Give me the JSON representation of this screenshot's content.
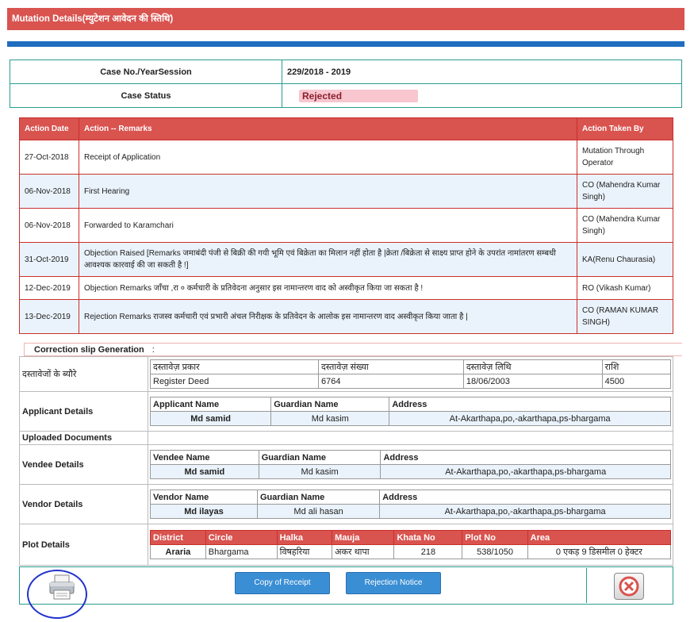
{
  "header": {
    "title": "Mutation Details(म्युटेशन आवेदन की स्तिथि)"
  },
  "case": {
    "case_label": "Case No./YearSession",
    "case_value": "229/2018 - 2019",
    "status_label": "Case Status",
    "status_value": "Rejected"
  },
  "actions": {
    "headers": [
      "Action Date",
      "Action -- Remarks",
      "Action Taken By"
    ],
    "rows": [
      {
        "date": "27-Oct-2018",
        "remark": "Receipt of Application",
        "by": "Mutation Through Operator"
      },
      {
        "date": "06-Nov-2018",
        "remark": "First Hearing",
        "by": "CO (Mahendra Kumar Singh)"
      },
      {
        "date": "06-Nov-2018",
        "remark": "Forwarded to Karamchari",
        "by": "CO (Mahendra Kumar Singh)"
      },
      {
        "date": "31-Oct-2019",
        "remark": "Objection Raised [Remarks जमाबंदी पंजी से बिक्री की गयी भूमि एवं बिक्रेता का मिलान नहीं होता है |क्रेता /बिक्रेता से साक्ष्य प्राप्त होने के उपरांत नामांतरण सम्बधी आवश्यक कारवाई की जा सकती है !]",
        "by": "KA(Renu Chaurasia)"
      },
      {
        "date": "12-Dec-2019",
        "remark": "Objection Remarks जाँचा ,रा ० कर्मचारी के प्रतिवेदना अनुसार इस नामान्तरण वाद को अस्वीकृत किया जा सकता है !",
        "by": "RO (Vikash Kumar)"
      },
      {
        "date": "13-Dec-2019",
        "remark": "Rejection Remarks राजस्व कर्मचारी एवं प्रभारी अंचल निरीक्षक के प्रतिवेदन के आलोक इस नामान्तरण वाद अस्वीकृत किया जाता है |",
        "by": "CO (RAMAN KUMAR SINGH)"
      }
    ]
  },
  "correction_slip": {
    "label": "Correction slip Generation",
    "sep": ":"
  },
  "documents": {
    "label": "दस्तावेजों के ब्यौरे",
    "headers": [
      "दस्तावेज़ प्रकार",
      "दस्तावेज़ संख्या",
      "दस्तावेज़ लिथि",
      "राशि"
    ],
    "values": [
      "Register Deed",
      "6764",
      "18/06/2003",
      "4500"
    ]
  },
  "applicant": {
    "label": "Applicant Details",
    "headers": [
      "Applicant Name",
      "Guardian Name",
      "Address"
    ],
    "values": [
      "Md samid",
      "Md kasim",
      "At-Akarthapa,po,-akarthapa,ps-bhargama"
    ]
  },
  "uploaded": {
    "label": "Uploaded Documents"
  },
  "vendee": {
    "label": "Vendee Details",
    "headers": [
      "Vendee Name",
      "Guardian Name",
      "Address"
    ],
    "values": [
      "Md samid",
      "Md kasim",
      "At-Akarthapa,po,-akarthapa,ps-bhargama"
    ]
  },
  "vendor": {
    "label": "Vendor Details",
    "headers": [
      "Vendor Name",
      "Guardian Name",
      "Address"
    ],
    "values": [
      "Md ilayas",
      "Md ali hasan",
      "At-Akarthapa,po,-akarthapa,ps-bhargama"
    ]
  },
  "plot": {
    "label": "Plot Details",
    "headers": [
      "District",
      "Circle",
      "Halka",
      "Mauja",
      "Khata No",
      "Plot No",
      "Area"
    ],
    "values": [
      "Araria",
      "Bhargama",
      "विषहरिया",
      "अकर थापा",
      "218",
      "538/1050",
      "0 एकड़ 9 डिसमील 0 हेक्टर"
    ]
  },
  "footer": {
    "receipt_label": "Copy of Receipt",
    "rejection_label": "Rejection Notice",
    "print_icon": "printer-icon",
    "close_icon": "close-icon"
  },
  "colors": {
    "accent": "#d9534f",
    "blue": "#1f6dbf",
    "teal": "#2a9d8f",
    "button": "#3a8ed4"
  }
}
